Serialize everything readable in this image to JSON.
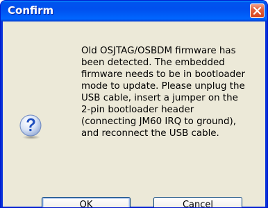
{
  "window": {
    "title": "Confirm"
  },
  "icons": {
    "dialog_icon": "question-icon",
    "close_icon": "close-icon"
  },
  "message": "Old OSJTAG/OSBDM firmware has\nbeen detected. The embedded\nfirmware needs to be in bootloader\nmode to update. Please unplug the\nUSB cable, insert a jumper on the\n2-pin bootloader header\n(connecting JM60 IRQ to ground),\nand reconnect the USB cable.",
  "buttons": {
    "ok_label": "OK",
    "cancel_label": "Cancel"
  },
  "colors": {
    "titlebar": "#0054e3",
    "close_button": "#e4613c",
    "client_background": "#ece9d8",
    "question_icon": "#2f5fcf"
  }
}
